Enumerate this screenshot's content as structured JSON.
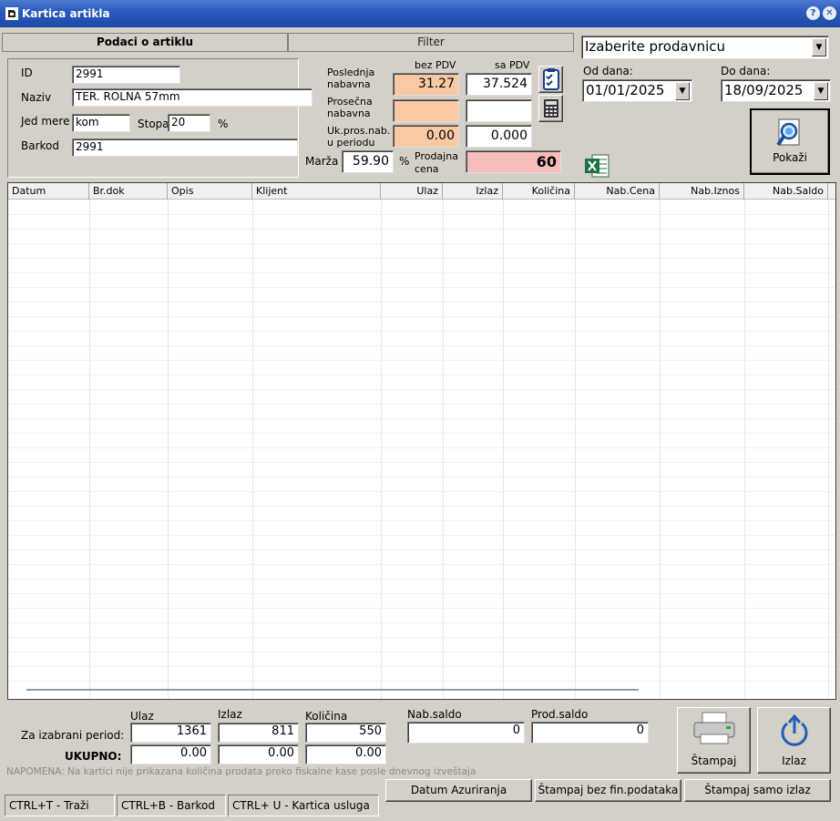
{
  "window": {
    "title": "Kartica artikla",
    "help_glyph": "?",
    "close_glyph": "✕"
  },
  "tabs": {
    "podaci": "Podaci o artiklu",
    "filter": "Filter"
  },
  "article": {
    "id_label": "ID",
    "id_value": "2991",
    "naziv_label": "Naziv",
    "naziv_value": "TER. ROLNA 57mm",
    "jed_mere_label": "Jed mere",
    "jed_mere_value": "kom",
    "stopa_label": "Stopa",
    "stopa_value": "20",
    "stopa_unit": "%",
    "barkod_label": "Barkod",
    "barkod_value": "2991"
  },
  "prices": {
    "bez_pdv_header": "bez PDV",
    "sa_pdv_header": "sa PDV",
    "poslednja_label_1": "Poslednja",
    "poslednja_label_2": "nabavna",
    "poslednja_bez": "31.27",
    "poslednja_sa": "37.524",
    "prosecna_label_1": "Prosečna",
    "prosecna_label_2": "nabavna",
    "prosecna_bez": "",
    "prosecna_sa": "",
    "ukpros_label_1": "Uk.pros.nab.",
    "ukpros_label_2": "u periodu",
    "ukpros_bez": "0.00",
    "ukpros_sa": "0.000",
    "marza_label": "Marža",
    "marza_value": "59.90",
    "marza_unit": "%",
    "prodajna_label_1": "Prodajna",
    "prodajna_label_2": "cena",
    "prodajna_value": "60"
  },
  "filters": {
    "store_placeholder": "Izaberite prodavnicu",
    "od_label": "Od dana:",
    "od_value": "01/01/2025",
    "do_label": "Do dana:",
    "do_value": "18/09/2025",
    "show_button": "Pokaži"
  },
  "grid": {
    "columns": [
      "Datum",
      "Br.dok",
      "Opis",
      "Klijent",
      "Ulaz",
      "Izlaz",
      "Količina",
      "Nab.Cena",
      "Nab.Iznos",
      "Nab.Saldo"
    ],
    "rows": []
  },
  "totals": {
    "period_label": "Za izabrani period:",
    "ukupno_label": "UKUPNO:",
    "ulaz_header": "Ulaz",
    "izlaz_header": "Izlaz",
    "kolicina_header": "Količina",
    "nab_saldo_header": "Nab.saldo",
    "prod_saldo_header": "Prod.saldo",
    "period_ulaz": "1361",
    "period_izlaz": "811",
    "period_kolicina": "550",
    "ukupno_ulaz": "0.00",
    "ukupno_izlaz": "0.00",
    "ukupno_kolicina": "0.00",
    "nab_saldo": "0",
    "prod_saldo": "0"
  },
  "note": "NAPOMENA: Na kartici nije prikazana količina prodata preko fiskalne kase posle dnevnog izveštaja",
  "buttons": {
    "stampaj": "Štampaj",
    "izlaz": "Izlaz",
    "datum_azuriranja": "Datum Azuriranja",
    "stampaj_bez": "Štampaj bez fin.podataka",
    "stampaj_samo_izlaz": "Štampaj samo izlaz"
  },
  "status": {
    "trazi": "CTRL+T - Traži",
    "barkod": "CTRL+B - Barkod",
    "usluga": "CTRL+ U - Kartica usluga"
  },
  "colors": {
    "titlebar": "#2a5bbd",
    "peach": "#f9c9a4",
    "pink": "#f7bcbc",
    "excel": "#1e7145"
  }
}
